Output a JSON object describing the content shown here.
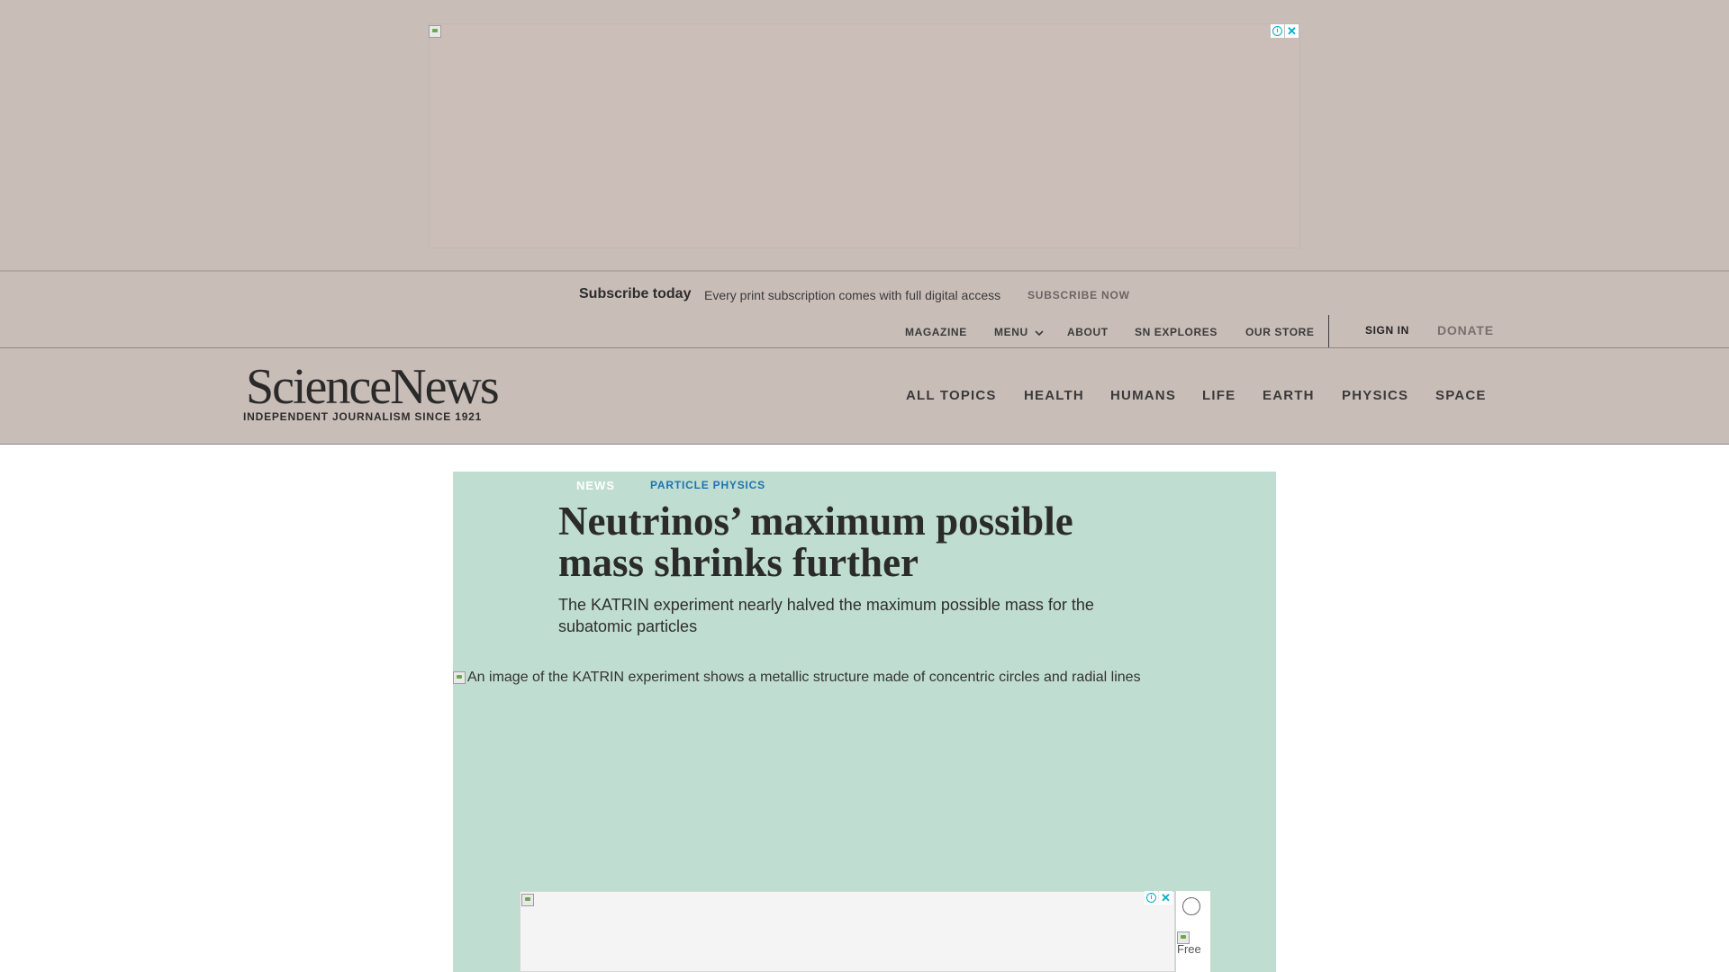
{
  "subscribe_bar": {
    "heading": "Subscribe today",
    "description": "Every print subscription comes with full digital access",
    "cta": "SUBSCRIBE NOW"
  },
  "utility_nav": {
    "items": [
      "MAGAZINE",
      "MENU",
      "ABOUT",
      "SN EXPLORES",
      "OUR STORE"
    ],
    "sign_in": "SIGN IN",
    "donate": "DONATE"
  },
  "brand": {
    "logo": "ScienceNews",
    "tagline": "INDEPENDENT JOURNALISM SINCE 1921"
  },
  "main_nav": {
    "items": [
      "ALL TOPICS",
      "HEALTH",
      "HUMANS",
      "LIFE",
      "EARTH",
      "PHYSICS",
      "SPACE"
    ]
  },
  "article": {
    "kicker": "NEWS",
    "topic": "PARTICLE PHYSICS",
    "headline": "Neutrinos’ maximum possible mass shrinks further",
    "dek": "The KATRIN experiment nearly halved the maximum possible mass for the subatomic particles",
    "hero_alt": "An image of the KATRIN experiment shows a metallic structure made of concentric circles and radial lines"
  },
  "ads": {
    "adchoices_icon": "adchoices-icon",
    "close_icon": "close-icon",
    "side_text": "Free"
  },
  "colors": {
    "overlay": "#c9bdb8",
    "card_background": "#c0ddd1",
    "topic_link": "#1b73b3",
    "adchoices": "#00aecd"
  }
}
